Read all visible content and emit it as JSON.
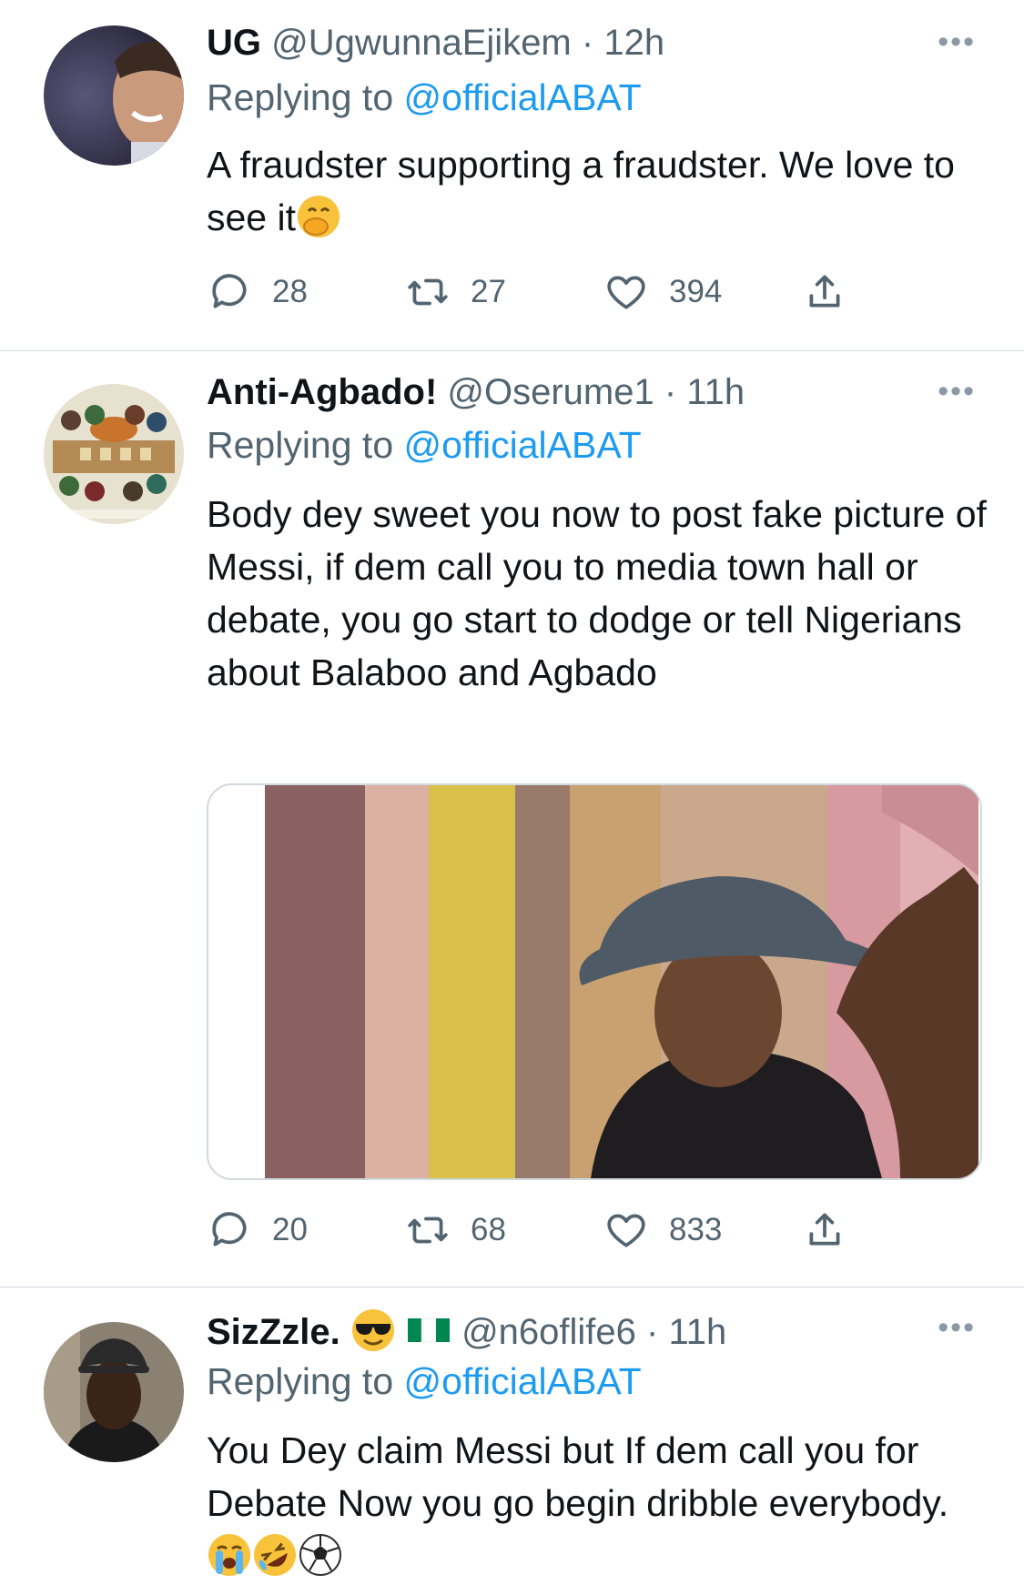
{
  "tweets": [
    {
      "name": "UG",
      "handle": "@UgwunnaEjikem",
      "dot": "·",
      "time": "12h",
      "replying_prefix": "Replying to",
      "replying_to": "@officialABAT",
      "text": "A fraudster supporting a fraudster. We love to see it",
      "emoji": [
        "face-with-hand-over-mouth-emoji"
      ],
      "replies": "28",
      "retweets": "27",
      "likes": "394"
    },
    {
      "name": "Anti-Agbado!",
      "handle": "@Oserume1",
      "dot": "·",
      "time": "11h",
      "replying_prefix": "Replying to",
      "replying_to": "@officialABAT",
      "text": "Body dey sweet you now to post fake picture of Messi, if dem call you to media town hall or debate, you go start to dodge or tell Nigerians about Balaboo and Agbado",
      "has_media": true,
      "replies": "20",
      "retweets": "68",
      "likes": "833"
    },
    {
      "name": "SizZzle.",
      "name_emoji": [
        "smiling-face-with-sunglasses-emoji",
        "nigeria-flag-emoji"
      ],
      "handle": "@n6oflife6",
      "dot": "·",
      "time": "11h",
      "replying_prefix": "Replying to",
      "replying_to": "@officialABAT",
      "text": "You Dey claim Messi but If dem call you for Debate Now you go begin dribble everybody.",
      "emoji": [
        "loudly-crying-face-emoji",
        "rolling-on-floor-laughing-emoji",
        "soccer-ball-emoji"
      ]
    }
  ],
  "colors": {
    "link": "#1d9bf0",
    "secondary": "#536471",
    "text": "#0f1419",
    "divider": "#cfd9de"
  }
}
